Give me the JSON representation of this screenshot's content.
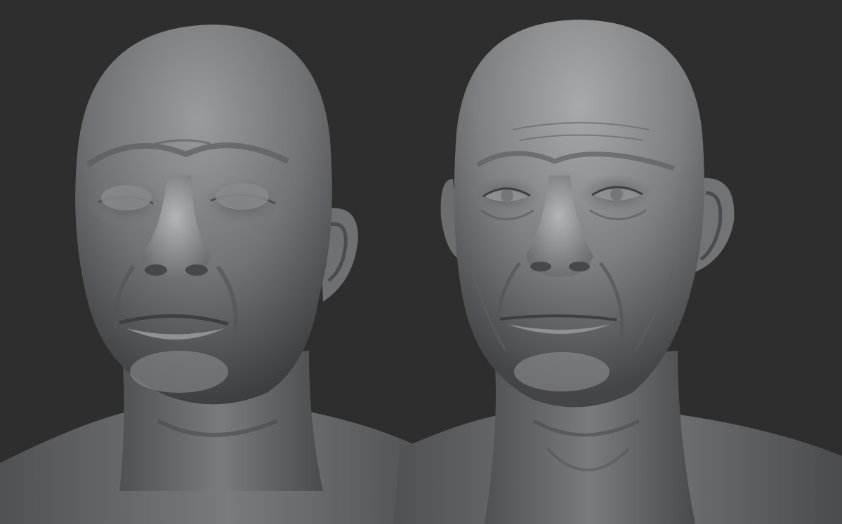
{
  "image": {
    "subject": "two-sculpted-heads",
    "style": "grey-clay-3d-render",
    "colors": {
      "background": "#2e2e2f",
      "clay_light": "#a5a6a8",
      "clay_mid": "#7c7d80",
      "clay_dark": "#3c3d40",
      "shadow": "#1f2022"
    }
  },
  "sculpts": [
    {
      "id": "left",
      "eyes": "closed-blank",
      "detail": "low"
    },
    {
      "id": "right",
      "eyes": "open",
      "detail": "high"
    }
  ]
}
